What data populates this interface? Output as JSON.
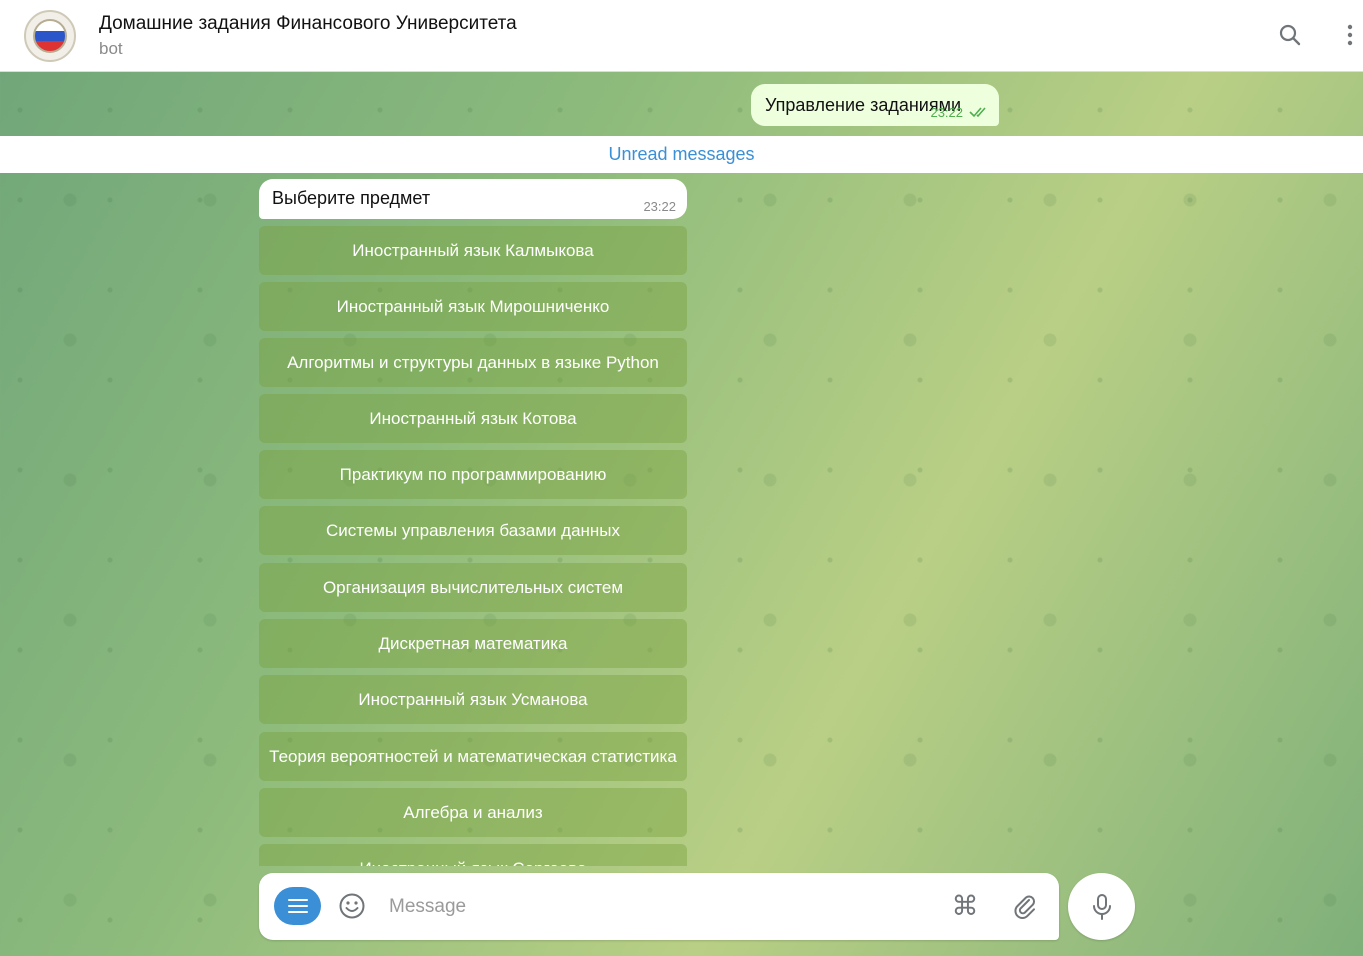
{
  "header": {
    "title": "Домашние задания Финансового Университета",
    "subtitle": "bot",
    "search_icon": "search-icon",
    "more_icon": "more-vertical-icon"
  },
  "messages": {
    "outgoing": {
      "text": "Управление заданиями",
      "time": "23:22"
    },
    "unread_label": "Unread messages",
    "incoming": {
      "text": "Выберите предмет",
      "time": "23:22"
    }
  },
  "keyboard": {
    "buttons": [
      "Иностранный язык Калмыкова",
      "Иностранный язык Мирошниченко",
      "Алгоритмы и структуры данных в языке Python",
      "Иностранный язык Котова",
      "Практикум по программированию",
      "Системы управления базами данных",
      "Организация вычислительных систем",
      "Дискретная математика",
      "Иностранный язык Усманова",
      "Теория вероятностей и математическая статистика",
      "Алгебра и анализ",
      "Иностранный язык Сергеева"
    ]
  },
  "composer": {
    "placeholder": "Message",
    "menu_icon": "menu-icon",
    "emoji_icon": "smile-icon",
    "commands_icon": "command-icon",
    "attach_icon": "paperclip-icon",
    "mic_icon": "microphone-icon"
  },
  "colors": {
    "accent": "#3a8fd6",
    "outgoing_bubble": "#eeffde",
    "check": "#4fae4e"
  }
}
